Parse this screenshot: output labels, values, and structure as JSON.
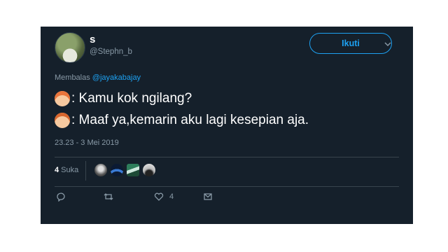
{
  "user": {
    "display_name": "s",
    "handle": "@Stephn_b"
  },
  "follow_label": "Ikuti",
  "reply": {
    "prefix": "Membalas ",
    "mention": "@jayakabajay"
  },
  "tweet": {
    "lines": [
      {
        "emoji": "woman-red-hair-emoji",
        "text": ": Kamu kok ngilang?"
      },
      {
        "emoji": "man-red-hair-emoji",
        "text": ": Maaf ya,kemarin aku lagi kesepian aja."
      }
    ]
  },
  "timestamp": "23.23 - 3 Mei 2019",
  "likes": {
    "count": "4",
    "label": " Suka"
  },
  "actions": {
    "like_count": "4"
  },
  "colors": {
    "background": "#15202b",
    "accent": "#1da1f2",
    "muted": "#8899a6"
  }
}
